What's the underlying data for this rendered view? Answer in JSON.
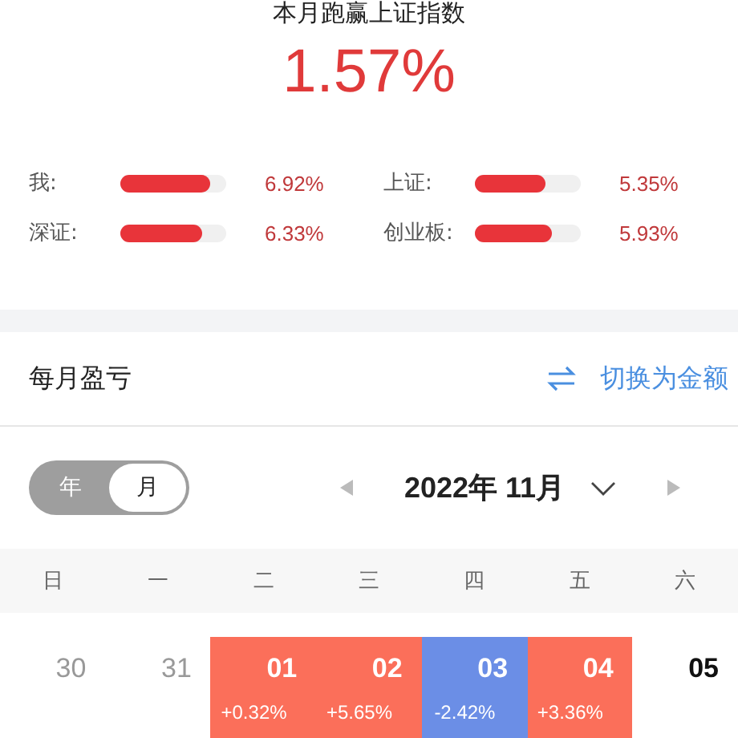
{
  "summary": {
    "title": "本月跑赢上证指数",
    "value": "1.57%"
  },
  "stats": [
    {
      "label": "我:",
      "level": 0.85,
      "value": "6.92%"
    },
    {
      "label": "上证:",
      "level": 0.67,
      "value": "5.35%"
    },
    {
      "label": "深证:",
      "level": 0.78,
      "value": "6.33%"
    },
    {
      "label": "创业板:",
      "level": 0.73,
      "value": "5.93%"
    }
  ],
  "section": {
    "title": "每月盈亏",
    "switch_label": "切换为金额"
  },
  "mode_toggle": [
    {
      "label": "年",
      "selected": false
    },
    {
      "label": "月",
      "selected": true
    }
  ],
  "month_picker": {
    "label": "2022年 11月"
  },
  "weekdays": [
    "日",
    "一",
    "二",
    "三",
    "四",
    "五",
    "六"
  ],
  "days": [
    {
      "day": "30",
      "kind": "other"
    },
    {
      "day": "31",
      "kind": "other"
    },
    {
      "day": "01",
      "kind": "up",
      "change": "+0.32%"
    },
    {
      "day": "02",
      "kind": "up",
      "change": "+5.65%"
    },
    {
      "day": "03",
      "kind": "down",
      "change": "-2.42%"
    },
    {
      "day": "04",
      "kind": "up",
      "change": "+3.36%"
    },
    {
      "day": "05",
      "kind": "plain"
    }
  ]
}
